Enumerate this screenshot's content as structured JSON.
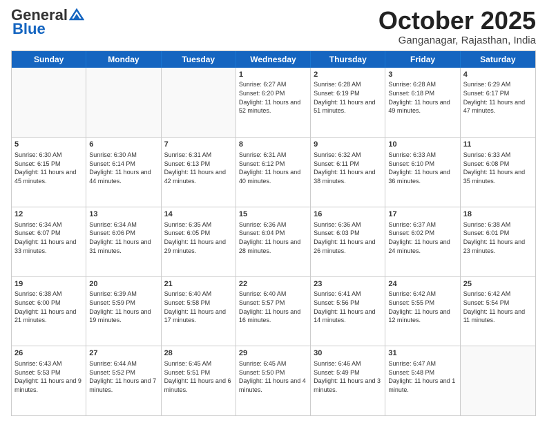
{
  "logo": {
    "general": "General",
    "blue": "Blue"
  },
  "title": "October 2025",
  "location": "Ganganagar, Rajasthan, India",
  "header_days": [
    "Sunday",
    "Monday",
    "Tuesday",
    "Wednesday",
    "Thursday",
    "Friday",
    "Saturday"
  ],
  "weeks": [
    [
      {
        "day": "",
        "info": ""
      },
      {
        "day": "",
        "info": ""
      },
      {
        "day": "",
        "info": ""
      },
      {
        "day": "1",
        "info": "Sunrise: 6:27 AM\nSunset: 6:20 PM\nDaylight: 11 hours and 52 minutes."
      },
      {
        "day": "2",
        "info": "Sunrise: 6:28 AM\nSunset: 6:19 PM\nDaylight: 11 hours and 51 minutes."
      },
      {
        "day": "3",
        "info": "Sunrise: 6:28 AM\nSunset: 6:18 PM\nDaylight: 11 hours and 49 minutes."
      },
      {
        "day": "4",
        "info": "Sunrise: 6:29 AM\nSunset: 6:17 PM\nDaylight: 11 hours and 47 minutes."
      }
    ],
    [
      {
        "day": "5",
        "info": "Sunrise: 6:30 AM\nSunset: 6:15 PM\nDaylight: 11 hours and 45 minutes."
      },
      {
        "day": "6",
        "info": "Sunrise: 6:30 AM\nSunset: 6:14 PM\nDaylight: 11 hours and 44 minutes."
      },
      {
        "day": "7",
        "info": "Sunrise: 6:31 AM\nSunset: 6:13 PM\nDaylight: 11 hours and 42 minutes."
      },
      {
        "day": "8",
        "info": "Sunrise: 6:31 AM\nSunset: 6:12 PM\nDaylight: 11 hours and 40 minutes."
      },
      {
        "day": "9",
        "info": "Sunrise: 6:32 AM\nSunset: 6:11 PM\nDaylight: 11 hours and 38 minutes."
      },
      {
        "day": "10",
        "info": "Sunrise: 6:33 AM\nSunset: 6:10 PM\nDaylight: 11 hours and 36 minutes."
      },
      {
        "day": "11",
        "info": "Sunrise: 6:33 AM\nSunset: 6:08 PM\nDaylight: 11 hours and 35 minutes."
      }
    ],
    [
      {
        "day": "12",
        "info": "Sunrise: 6:34 AM\nSunset: 6:07 PM\nDaylight: 11 hours and 33 minutes."
      },
      {
        "day": "13",
        "info": "Sunrise: 6:34 AM\nSunset: 6:06 PM\nDaylight: 11 hours and 31 minutes."
      },
      {
        "day": "14",
        "info": "Sunrise: 6:35 AM\nSunset: 6:05 PM\nDaylight: 11 hours and 29 minutes."
      },
      {
        "day": "15",
        "info": "Sunrise: 6:36 AM\nSunset: 6:04 PM\nDaylight: 11 hours and 28 minutes."
      },
      {
        "day": "16",
        "info": "Sunrise: 6:36 AM\nSunset: 6:03 PM\nDaylight: 11 hours and 26 minutes."
      },
      {
        "day": "17",
        "info": "Sunrise: 6:37 AM\nSunset: 6:02 PM\nDaylight: 11 hours and 24 minutes."
      },
      {
        "day": "18",
        "info": "Sunrise: 6:38 AM\nSunset: 6:01 PM\nDaylight: 11 hours and 23 minutes."
      }
    ],
    [
      {
        "day": "19",
        "info": "Sunrise: 6:38 AM\nSunset: 6:00 PM\nDaylight: 11 hours and 21 minutes."
      },
      {
        "day": "20",
        "info": "Sunrise: 6:39 AM\nSunset: 5:59 PM\nDaylight: 11 hours and 19 minutes."
      },
      {
        "day": "21",
        "info": "Sunrise: 6:40 AM\nSunset: 5:58 PM\nDaylight: 11 hours and 17 minutes."
      },
      {
        "day": "22",
        "info": "Sunrise: 6:40 AM\nSunset: 5:57 PM\nDaylight: 11 hours and 16 minutes."
      },
      {
        "day": "23",
        "info": "Sunrise: 6:41 AM\nSunset: 5:56 PM\nDaylight: 11 hours and 14 minutes."
      },
      {
        "day": "24",
        "info": "Sunrise: 6:42 AM\nSunset: 5:55 PM\nDaylight: 11 hours and 12 minutes."
      },
      {
        "day": "25",
        "info": "Sunrise: 6:42 AM\nSunset: 5:54 PM\nDaylight: 11 hours and 11 minutes."
      }
    ],
    [
      {
        "day": "26",
        "info": "Sunrise: 6:43 AM\nSunset: 5:53 PM\nDaylight: 11 hours and 9 minutes."
      },
      {
        "day": "27",
        "info": "Sunrise: 6:44 AM\nSunset: 5:52 PM\nDaylight: 11 hours and 7 minutes."
      },
      {
        "day": "28",
        "info": "Sunrise: 6:45 AM\nSunset: 5:51 PM\nDaylight: 11 hours and 6 minutes."
      },
      {
        "day": "29",
        "info": "Sunrise: 6:45 AM\nSunset: 5:50 PM\nDaylight: 11 hours and 4 minutes."
      },
      {
        "day": "30",
        "info": "Sunrise: 6:46 AM\nSunset: 5:49 PM\nDaylight: 11 hours and 3 minutes."
      },
      {
        "day": "31",
        "info": "Sunrise: 6:47 AM\nSunset: 5:48 PM\nDaylight: 11 hours and 1 minute."
      },
      {
        "day": "",
        "info": ""
      }
    ]
  ]
}
